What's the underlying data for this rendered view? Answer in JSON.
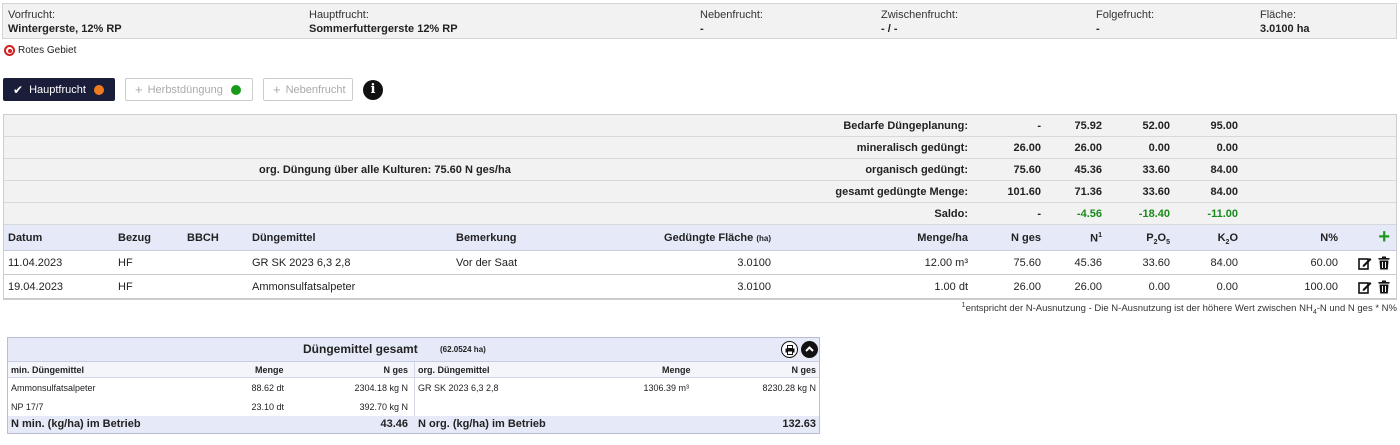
{
  "crop": {
    "vorfrucht": {
      "label": "Vorfrucht:",
      "value": "Wintergerste, 12% RP"
    },
    "hauptfrucht": {
      "label": "Hauptfrucht:",
      "value": "Sommerfuttergerste 12% RP"
    },
    "nebenfrucht": {
      "label": "Nebenfrucht:",
      "value": "-"
    },
    "zwischenfrucht": {
      "label": "Zwischenfrucht:",
      "value": "- / -"
    },
    "folgefrucht": {
      "label": "Folgefrucht:",
      "value": "-"
    },
    "flaeche": {
      "label": "Fläche:",
      "value": "3.0100 ha"
    }
  },
  "red_zone": {
    "icon": "target-icon",
    "label": "Rotes Gebiet"
  },
  "tabs": [
    {
      "label": "Hauptfrucht",
      "state": "active",
      "dot_color": "#f07a1e"
    },
    {
      "label": "Herbstdüngung",
      "state": "disabled",
      "dot_color": "#1a9a1a"
    },
    {
      "label": "Nebenfrucht",
      "state": "disabled"
    }
  ],
  "summary": {
    "org_total": "org. Düngung über alle Kulturen: 75.60 N ges/ha",
    "rows": [
      {
        "label": "Bedarfe Düngeplanung:",
        "v1": "-",
        "v2": "75.92",
        "v3": "52.00",
        "v4": "95.00"
      },
      {
        "label": "mineralisch gedüngt:",
        "v1": "26.00",
        "v2": "26.00",
        "v3": "0.00",
        "v4": "0.00"
      },
      {
        "label": "organisch gedüngt:",
        "v1": "75.60",
        "v2": "45.36",
        "v3": "33.60",
        "v4": "84.00"
      },
      {
        "label": "gesamt gedüngte Menge:",
        "v1": "101.60",
        "v2": "71.36",
        "v3": "33.60",
        "v4": "84.00"
      },
      {
        "label": "Saldo:",
        "v1": "-",
        "v2": "-4.56",
        "v3": "-18.40",
        "v4": "-11.00"
      }
    ]
  },
  "table": {
    "headers": {
      "datum": "Datum",
      "bezug": "Bezug",
      "bbch": "BBCH",
      "duengemittel": "Düngemittel",
      "bemerkung": "Bemerkung",
      "flaeche": "Gedüngte Fläche",
      "flaeche_unit": "(ha)",
      "menge": "Menge/ha",
      "nges": "N ges",
      "n1": "N",
      "n1_sup": "1",
      "p2o5_a": "P",
      "p2o5_sub1": "2",
      "p2o5_b": "O",
      "p2o5_sub2": "5",
      "k2o_a": "K",
      "k2o_sub": "2",
      "k2o_b": "O",
      "npct": "N%"
    },
    "rows": [
      {
        "datum": "11.04.2023",
        "bezug": "HF",
        "bbch": "",
        "duengemittel": "GR SK 2023 6,3 2,8",
        "bemerkung": "Vor der Saat",
        "flaeche": "3.0100",
        "menge": "12.00 m³",
        "nges": "75.60",
        "n": "45.36",
        "p2o5": "33.60",
        "k2o": "84.00",
        "npct": "60.00"
      },
      {
        "datum": "19.04.2023",
        "bezug": "HF",
        "bbch": "",
        "duengemittel": "Ammonsulfatsalpeter",
        "bemerkung": "",
        "flaeche": "3.0100",
        "menge": "1.00 dt",
        "nges": "26.00",
        "n": "26.00",
        "p2o5": "0.00",
        "k2o": "0.00",
        "npct": "100.00"
      }
    ],
    "footnote_sup": "1",
    "footnote_a": "entspricht der N-Ausnutzung - Die N-Ausnutzung ist der höhere Wert zwischen NH",
    "footnote_sub": "4",
    "footnote_b": "-N und N ges * N%"
  },
  "total": {
    "title": "Düngemittel gesamt",
    "subtitle": "(62.0524 ha)",
    "min_header": {
      "name": "min. Düngemittel",
      "menge": "Menge",
      "nges": "N ges"
    },
    "org_header": {
      "name": "org. Düngemittel",
      "menge": "Menge",
      "nges": "N ges"
    },
    "min_rows": [
      {
        "name": "Ammonsulfatsalpeter",
        "menge": "88.62 dt",
        "nges": "2304.18 kg N"
      },
      {
        "name": "NP 17/7",
        "menge": "23.10 dt",
        "nges": "392.70 kg N"
      }
    ],
    "org_rows": [
      {
        "name": "GR SK 2023 6,3 2,8",
        "menge": "1306.39 m³",
        "nges": "8230.28 kg N"
      }
    ],
    "min_footer": {
      "label": "N min. (kg/ha) im Betrieb",
      "value": "43.46"
    },
    "org_footer": {
      "label": "N org. (kg/ha) im Betrieb",
      "value": "132.63"
    }
  }
}
